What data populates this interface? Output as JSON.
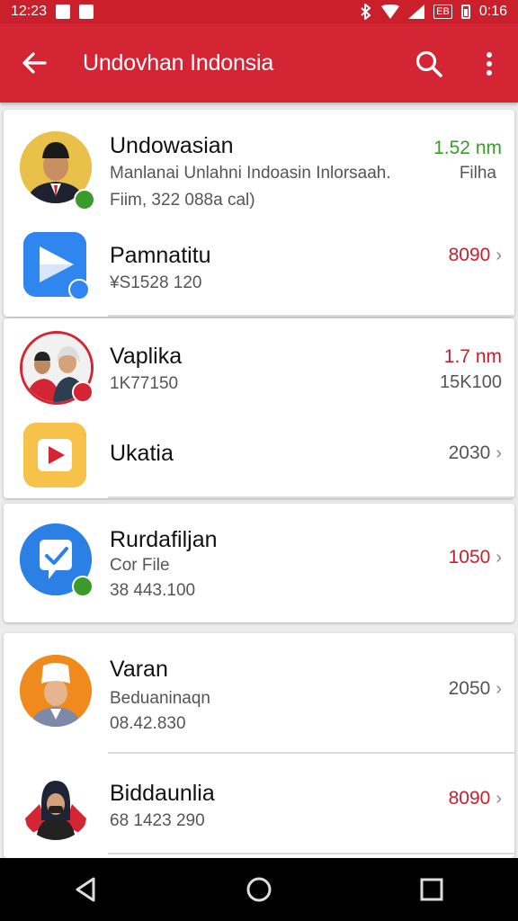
{
  "status_bar": {
    "time": "12:23",
    "right_time": "0:16",
    "tag": "EB"
  },
  "app_bar": {
    "title": "Undovhan Indonsia",
    "back_icon": "back-arrow-icon",
    "search_icon": "search-icon",
    "more_icon": "more-vert-icon"
  },
  "colors": {
    "brand_red": "#d42534",
    "value_red": "#c9202c",
    "value_green": "#3a9b2a"
  },
  "items": [
    {
      "name": "Undowasian",
      "line1": "Manlanai Unlahni Indoasin Inlorsaah.",
      "line1_right": "Filha",
      "line2": "Fiim, 322 088a cal)",
      "value": "1.52 nm",
      "value_color": "green"
    },
    {
      "name": "Pamnatitu",
      "line1": "¥S1528 120",
      "value": "8090"
    },
    {
      "name": "Vaplika",
      "line1": "1K77150",
      "value": "1.7 nm",
      "value2": "15K100"
    },
    {
      "name": "Ukatia",
      "value": "2030"
    },
    {
      "name": "Rurdafiljan",
      "line1": "Cor File",
      "line2": "38 443.100",
      "value": "1050"
    },
    {
      "name": "Varan",
      "line1": "Beduaninaqn",
      "line2": "08.42.830",
      "value": "2050"
    },
    {
      "name": "Biddaunlia",
      "line1": "68 1423 290",
      "value": "8090"
    }
  ],
  "chevron": "›",
  "nav_bar": {
    "back": "nav-back-icon",
    "home": "nav-home-icon",
    "recents": "nav-recents-icon"
  }
}
